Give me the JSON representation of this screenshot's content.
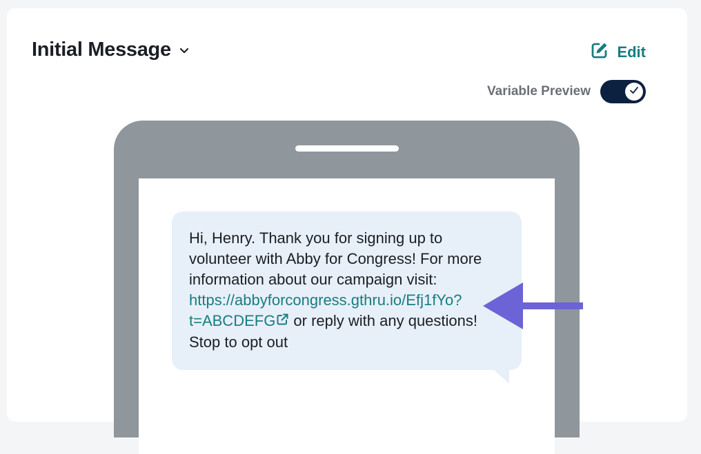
{
  "header": {
    "title": "Initial Message",
    "edit_label": "Edit",
    "variable_preview_label": "Variable Preview",
    "variable_preview_on": true
  },
  "message": {
    "line1": "Hi, Henry. Thank you for signing up to",
    "line2": "volunteer with Abby for Congress! For more",
    "line3": "information about our campaign visit:",
    "link_part1": "https://abbyforcongress.gthru.io/Efj1fYo?",
    "link_part2": "t=ABCDEFG",
    "after_link": " or reply with any questions!",
    "line6": "Stop to opt out"
  },
  "colors": {
    "accent_teal": "#177d81",
    "toggle_navy": "#0c2140",
    "phone_gray": "#8f969c",
    "bubble_bg": "#e7eff8",
    "arrow_purple": "#6c63d6"
  },
  "icons": [
    "chevron-down-icon",
    "edit-icon",
    "check-icon",
    "external-link-icon",
    "arrow-left-icon"
  ]
}
